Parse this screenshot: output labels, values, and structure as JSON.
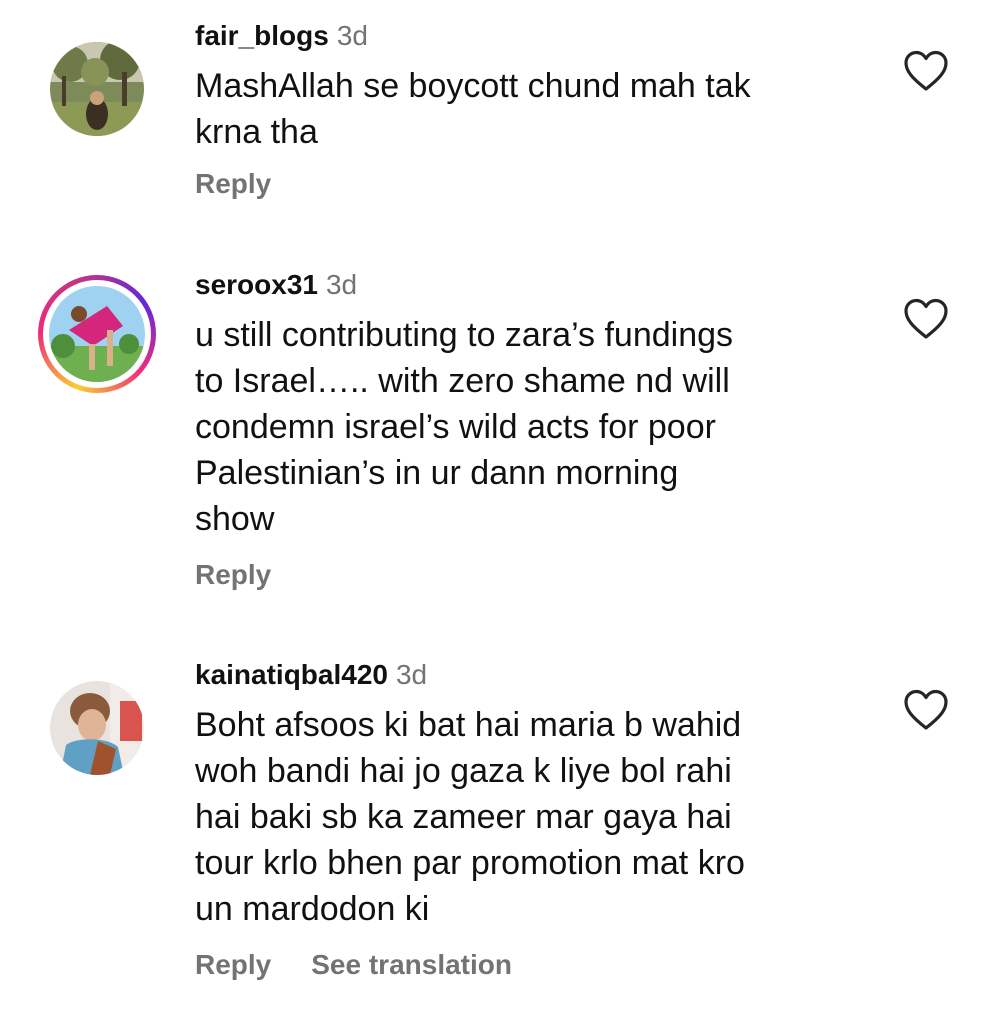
{
  "comments": [
    {
      "username": "fair_blogs",
      "time": "3d",
      "lines": [
        "MashAllah se boycott chund mah tak",
        "krna tha"
      ],
      "reply_label": "Reply"
    },
    {
      "username": "seroox31",
      "time": "3d",
      "lines": [
        "u still contributing to zara’s fundings",
        "to Israel….. with zero shame nd will",
        "condemn israel’s wild acts for poor",
        "Palestinian’s in ur dann morning",
        "show"
      ],
      "reply_label": "Reply",
      "story_ring": true
    },
    {
      "username": "kainatiqbal420",
      "time": "3d",
      "lines": [
        "Boht afsoos ki bat hai maria b wahid",
        "woh bandi hai jo gaza k liye bol rahi",
        "hai baki sb ka zameer mar gaya hai",
        "tour krlo bhen par promotion mat kro",
        "un mardodon ki"
      ],
      "reply_label": "Reply",
      "translation_label": "See translation"
    }
  ],
  "icons": {
    "like": "heart-outline-icon"
  },
  "colors": {
    "text": "#111111",
    "secondary": "#737373",
    "story_ring_start": "#f9ce34",
    "story_ring_end": "#c13584"
  }
}
